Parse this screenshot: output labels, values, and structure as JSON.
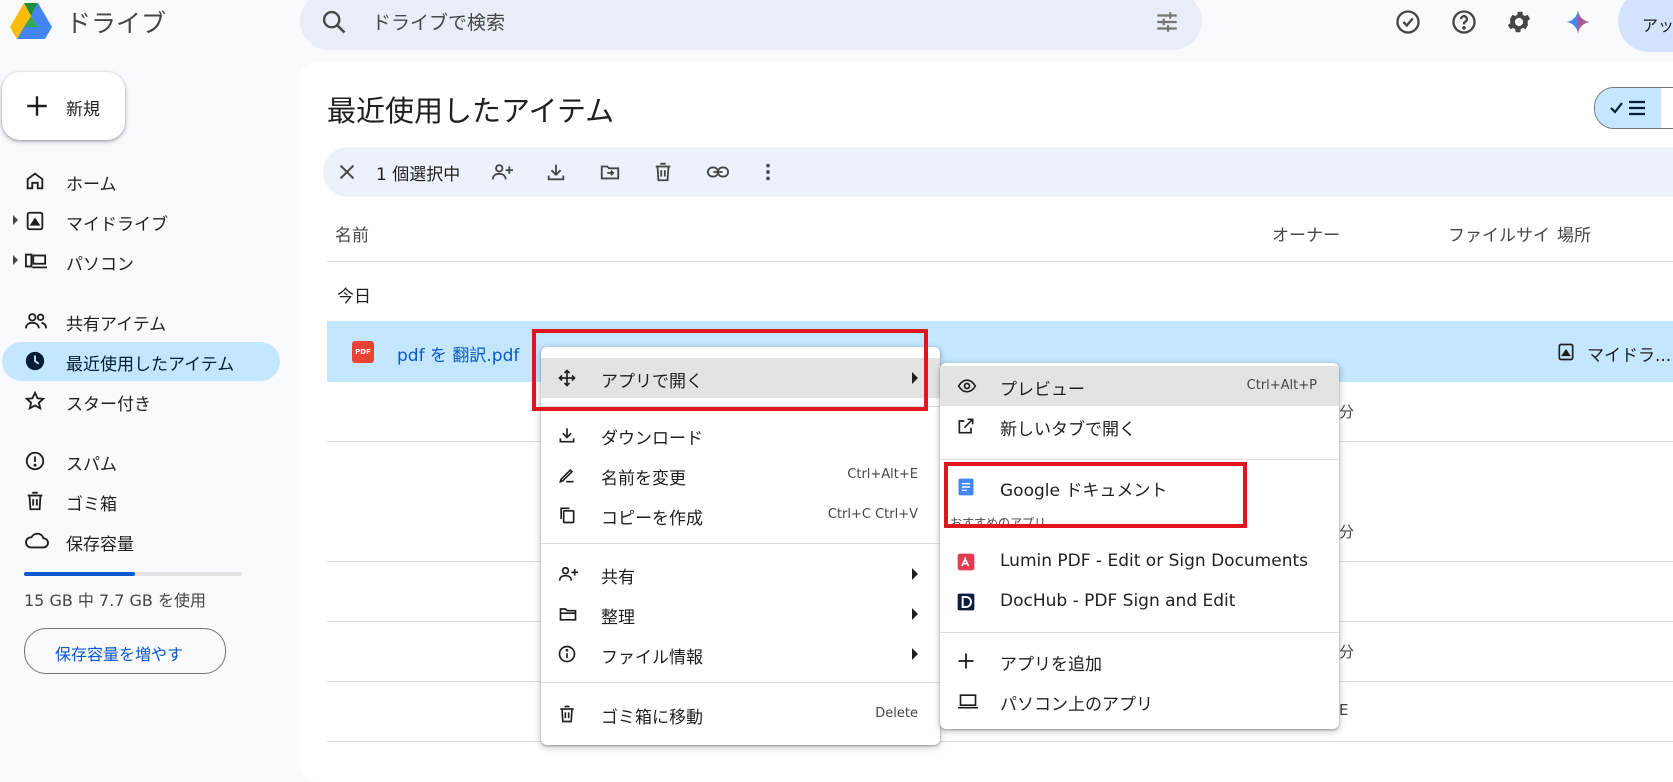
{
  "header": {
    "app_title": "ドライブ",
    "search_placeholder": "ドライブで検索",
    "account_label": "アッ"
  },
  "sidebar": {
    "new_button": "新規",
    "items": [
      {
        "label": "ホーム",
        "icon": "home-icon"
      },
      {
        "label": "マイドライブ",
        "icon": "my-drive-icon"
      },
      {
        "label": "パソコン",
        "icon": "computers-icon"
      },
      {
        "label": "共有アイテム",
        "icon": "shared-icon"
      },
      {
        "label": "最近使用したアイテム",
        "icon": "recent-icon",
        "selected": true
      },
      {
        "label": "スター付き",
        "icon": "star-icon"
      },
      {
        "label": "スパム",
        "icon": "spam-icon"
      },
      {
        "label": "ゴミ箱",
        "icon": "trash-icon"
      },
      {
        "label": "保存容量",
        "icon": "cloud-icon"
      }
    ],
    "storage": {
      "used_fraction": 0.51,
      "text": "15 GB 中 7.7 GB を使用",
      "button": "保存容量を増やす"
    }
  },
  "main": {
    "title": "最近使用したアイテム",
    "selection": {
      "count_text": "1 個選択中"
    },
    "columns": {
      "name": "名前",
      "owner": "オーナー",
      "size": "ファイルサイ",
      "location": "場所"
    },
    "group_today": "今日",
    "selected_file": {
      "name": "pdf を 翻訳.pdf",
      "icon_text": "PDF",
      "location": "マイドラ..."
    },
    "row_peeks": [
      "分",
      "分",
      "分",
      "分",
      "E"
    ]
  },
  "context_menu": {
    "items": [
      {
        "label": "アプリで開く",
        "icon": "move-icon",
        "submenu": true
      },
      {
        "label": "ダウンロード",
        "icon": "download-icon"
      },
      {
        "label": "名前を変更",
        "icon": "rename-icon",
        "shortcut": "Ctrl+Alt+E"
      },
      {
        "label": "コピーを作成",
        "icon": "copy-icon",
        "shortcut": "Ctrl+C Ctrl+V"
      },
      {
        "label": "共有",
        "icon": "share-icon",
        "submenu": true
      },
      {
        "label": "整理",
        "icon": "folder-icon",
        "submenu": true
      },
      {
        "label": "ファイル情報",
        "icon": "info-icon",
        "submenu": true
      },
      {
        "label": "ゴミ箱に移動",
        "icon": "trash-icon",
        "shortcut": "Delete"
      }
    ]
  },
  "open_with_menu": {
    "items": [
      {
        "label": "プレビュー",
        "icon": "eye-icon",
        "shortcut": "Ctrl+Alt+P"
      },
      {
        "label": "新しいタブで開く",
        "icon": "open-new-tab-icon"
      },
      {
        "label": "Google ドキュメント",
        "icon": "google-docs-icon"
      },
      {
        "label": "Lumin PDF - Edit or Sign Documents",
        "icon": "lumin-icon"
      },
      {
        "label": "DocHub - PDF Sign and Edit",
        "icon": "dochub-icon"
      },
      {
        "label": "アプリを追加",
        "icon": "plus-icon"
      },
      {
        "label": "パソコン上のアプリ",
        "icon": "laptop-icon"
      }
    ],
    "suggested_caption": "おすすめのアプリ"
  },
  "colors": {
    "accent": "#0b57d0",
    "selected_bg": "#c2e7ff",
    "highlight_red": "#e0151e"
  }
}
